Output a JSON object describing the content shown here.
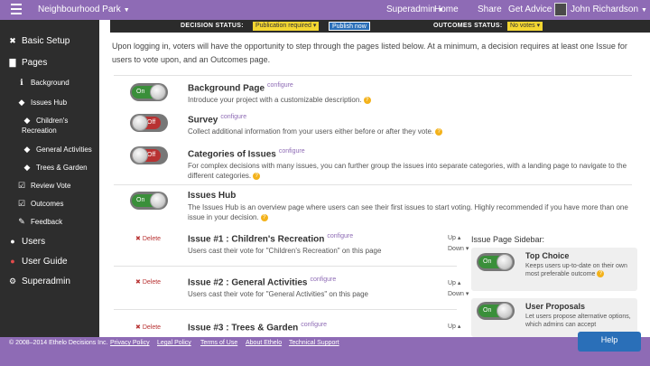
{
  "topbar": {
    "site_name": "Neighbourhood Park",
    "role": "Superadmin",
    "links": [
      "Home",
      "Share",
      "Get Advice"
    ],
    "user_name": "John Richardson"
  },
  "status": {
    "decision_label": "DECISION STATUS:",
    "decision_value": "Publication required",
    "publish_button": "Publish now",
    "outcomes_label": "OUTCOMES STATUS:",
    "outcomes_value": "No votes"
  },
  "sidebar": {
    "items": [
      {
        "label": "Basic Setup",
        "icon": "wrench-icon"
      },
      {
        "label": "Pages",
        "icon": "pages-icon"
      },
      {
        "label": "Background",
        "icon": "info-icon"
      },
      {
        "label": "Issues Hub",
        "icon": "tag-icon"
      },
      {
        "label": "Children's Recreation",
        "icon": "tag-icon"
      },
      {
        "label": "General Activities",
        "icon": "tag-icon"
      },
      {
        "label": "Trees & Garden",
        "icon": "tag-icon"
      },
      {
        "label": "Review Vote",
        "icon": "checkbox-icon"
      },
      {
        "label": "Outcomes",
        "icon": "checkbox-icon"
      },
      {
        "label": "Feedback",
        "icon": "edit-icon"
      },
      {
        "label": "Users",
        "icon": "users-icon"
      },
      {
        "label": "User Guide",
        "icon": "question-icon"
      },
      {
        "label": "Superadmin",
        "icon": "gears-icon"
      }
    ]
  },
  "main": {
    "intro": "Upon logging in, voters will have the opportunity to step through the pages listed below. At a minimum, a decision requires at least one Issue for users to vote upon, and an Outcomes page.",
    "configure": "configure",
    "delete": "Delete",
    "up": "Up",
    "down": "Down",
    "pages": [
      {
        "title": "Background Page",
        "state": "On",
        "desc": "Introduce your project with a customizable description."
      },
      {
        "title": "Survey",
        "state": "Off",
        "desc": "Collect additional information from your users either before or after they vote."
      },
      {
        "title": "Categories of Issues",
        "state": "Off",
        "desc": "For complex decisions with many issues, you can further group the issues into separate categories, with a landing page to navigate to the different categories."
      },
      {
        "title": "Issues Hub",
        "state": "On",
        "desc": "The Issues Hub is an overview page where users can see their first issues to start voting. Highly recommended if you have more than one issue in your decision."
      }
    ],
    "issues": [
      {
        "title": "Issue #1 : Children's Recreation",
        "desc": "Users cast their vote for \"Children's Recreation\" on this page"
      },
      {
        "title": "Issue #2 : General Activities",
        "desc": "Users cast their vote for \"General Activities\" on this page"
      },
      {
        "title": "Issue #3 : Trees & Garden",
        "desc": ""
      }
    ],
    "issue_sidebar": {
      "title": "Issue Page Sidebar:",
      "cards": [
        {
          "title": "Top Choice",
          "state": "On",
          "desc": "Keeps users up-to-date on their own most preferable outcome"
        },
        {
          "title": "User Proposals",
          "state": "On",
          "desc": "Let users propose alternative options, which admins can accept"
        }
      ]
    }
  },
  "footer": {
    "copyright": "© 2008–2014 Ethelo Decisions Inc.",
    "links": [
      "Privacy Policy",
      "Legal Policy",
      "Terms of Use",
      "About Ethelo",
      "Technical Support"
    ],
    "help_button": "Help"
  },
  "colors": {
    "brand": "#8e6bb5",
    "on": "#3a8f3a",
    "off": "#b83232",
    "publish": "#2a6fb8",
    "status": "#f3d631"
  }
}
